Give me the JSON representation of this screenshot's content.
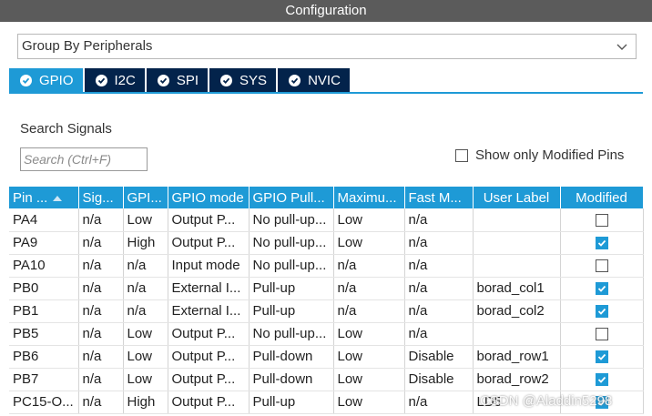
{
  "window": {
    "title": "Configuration"
  },
  "group_by": {
    "value": "Group By Peripherals"
  },
  "tabs": [
    {
      "label": "GPIO",
      "active": true
    },
    {
      "label": "I2C",
      "active": false
    },
    {
      "label": "SPI",
      "active": false
    },
    {
      "label": "SYS",
      "active": false
    },
    {
      "label": "NVIC",
      "active": false
    }
  ],
  "search": {
    "label": "Search Signals",
    "placeholder": "Search (Ctrl+F)"
  },
  "show_modified": {
    "label": "Show only Modified Pins",
    "checked": false
  },
  "table": {
    "headers": [
      "Pin ...",
      "Sig...",
      "GPI...",
      "GPIO mode",
      "GPIO Pull...",
      "Maximu...",
      "Fast M...",
      "User Label",
      "Modified"
    ],
    "rows": [
      {
        "pin": "PA4",
        "signal": "n/a",
        "gpio_output": "Low",
        "mode": "Output P...",
        "pull": "No pull-up...",
        "max_speed": "Low",
        "fast_mode": "n/a",
        "user_label": "",
        "modified": false
      },
      {
        "pin": "PA9",
        "signal": "n/a",
        "gpio_output": "High",
        "mode": "Output P...",
        "pull": "No pull-up...",
        "max_speed": "Low",
        "fast_mode": "n/a",
        "user_label": "",
        "modified": true
      },
      {
        "pin": "PA10",
        "signal": "n/a",
        "gpio_output": "n/a",
        "mode": "Input mode",
        "pull": "No pull-up...",
        "max_speed": "n/a",
        "fast_mode": "n/a",
        "user_label": "",
        "modified": false
      },
      {
        "pin": "PB0",
        "signal": "n/a",
        "gpio_output": "n/a",
        "mode": "External I...",
        "pull": "Pull-up",
        "max_speed": "n/a",
        "fast_mode": "n/a",
        "user_label": "borad_col1",
        "modified": true
      },
      {
        "pin": "PB1",
        "signal": "n/a",
        "gpio_output": "n/a",
        "mode": "External I...",
        "pull": "Pull-up",
        "max_speed": "n/a",
        "fast_mode": "n/a",
        "user_label": "borad_col2",
        "modified": true
      },
      {
        "pin": "PB5",
        "signal": "n/a",
        "gpio_output": "Low",
        "mode": "Output P...",
        "pull": "No pull-up...",
        "max_speed": "Low",
        "fast_mode": "n/a",
        "user_label": "",
        "modified": false
      },
      {
        "pin": "PB6",
        "signal": "n/a",
        "gpio_output": "Low",
        "mode": "Output P...",
        "pull": "Pull-down",
        "max_speed": "Low",
        "fast_mode": "Disable",
        "user_label": "borad_row1",
        "modified": true
      },
      {
        "pin": "PB7",
        "signal": "n/a",
        "gpio_output": "Low",
        "mode": "Output P...",
        "pull": "Pull-down",
        "max_speed": "Low",
        "fast_mode": "Disable",
        "user_label": "borad_row2",
        "modified": true
      },
      {
        "pin": "PC15-O...",
        "signal": "n/a",
        "gpio_output": "High",
        "mode": "Output P...",
        "pull": "Pull-up",
        "max_speed": "Low",
        "fast_mode": "n/a",
        "user_label": "LD5",
        "modified": true
      }
    ]
  },
  "watermark": "CSDN @Aladdin5298",
  "colors": {
    "accent": "#1e9ad6",
    "tab_dark": "#03234b",
    "title_bar": "#5b5b5b"
  }
}
